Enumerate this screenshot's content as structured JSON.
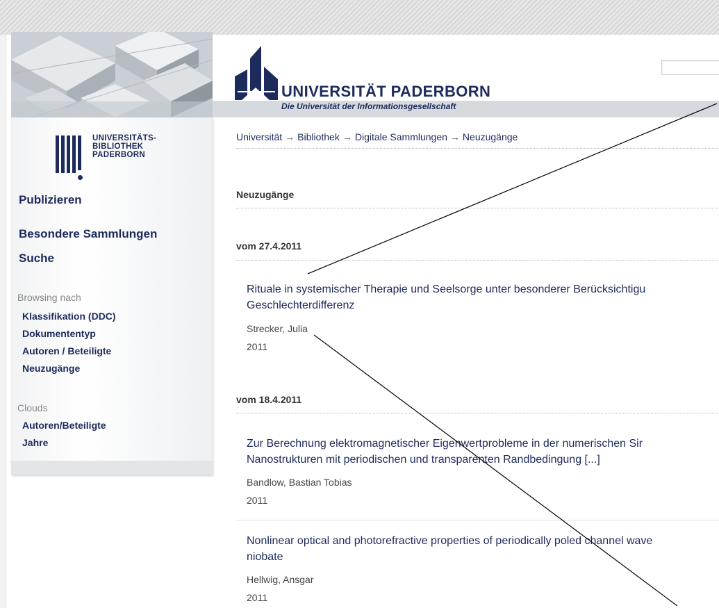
{
  "header": {
    "university_name": "UNIVERSITÄT PADERBORN",
    "university_tagline": "Die Universität der Informationsgesellschaft",
    "search_value": ""
  },
  "library_logo": {
    "lines": [
      "UNIVERSITÄTS-",
      "BIBLIOTHEK",
      "PADERBORN"
    ]
  },
  "sidebar": {
    "primary": [
      "Publizieren",
      "Besondere Sammlungen",
      "Suche"
    ],
    "browse_caption": "Browsing nach",
    "browse_items": [
      "Klassifikation (DDC)",
      "Dokumententyp",
      "Autoren / Beteiligte",
      "Neuzugänge"
    ],
    "clouds_caption": "Clouds",
    "cloud_items": [
      "Autoren/Beteiligte",
      "Jahre"
    ]
  },
  "breadcrumb": [
    "Universität",
    "Bibliothek",
    "Digitale Sammlungen",
    "Neuzugänge"
  ],
  "breadcrumb_separator": "→",
  "main": {
    "heading": "Neuzugänge",
    "groups": [
      {
        "date_label": "vom 27.4.2011",
        "records": [
          {
            "title_lines": [
              "Rituale in systemischer Therapie und Seelsorge unter besonderer Berücksichtigu",
              "Geschlechterdifferenz"
            ],
            "author": "Strecker, Julia",
            "year": "2011"
          }
        ]
      },
      {
        "date_label": "vom 18.4.2011",
        "records": [
          {
            "title_lines": [
              "Zur Berechnung elektromagnetischer Eigenwertprobleme in der numerischen Sir",
              "Nanostrukturen mit periodischen und transparenten Randbedingung [...]"
            ],
            "author": "Bandlow, Bastian Tobias",
            "year": "2011"
          },
          {
            "title_lines": [
              "Nonlinear optical and photorefractive properties of periodically poled channel wave",
              "niobate"
            ],
            "author": "Hellwig, Ansgar",
            "year": "2011"
          }
        ]
      }
    ]
  },
  "colors": {
    "brand_blue": "#1d2a5c",
    "text_gray": "#444444",
    "caption_gray": "#888888"
  }
}
